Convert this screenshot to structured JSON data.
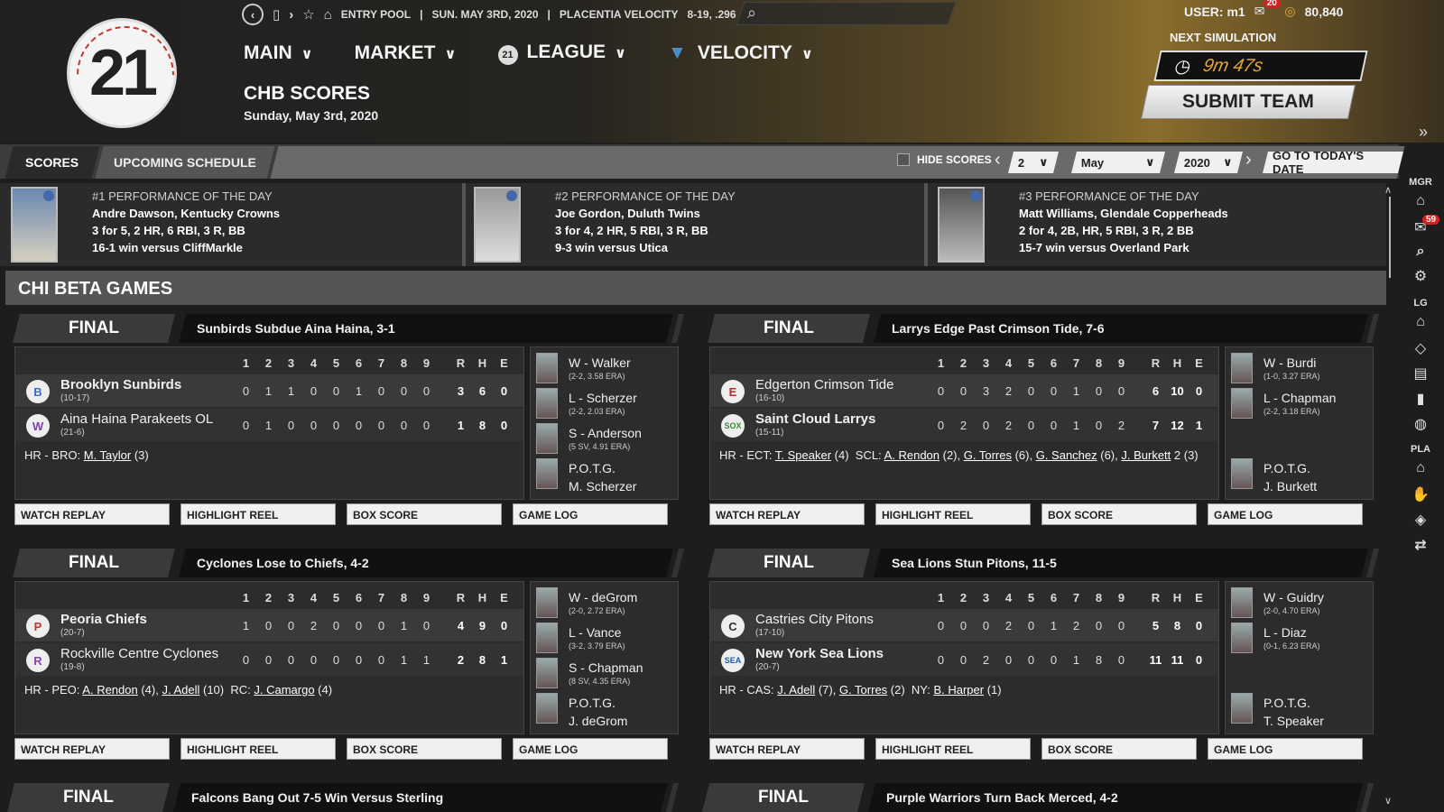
{
  "header": {
    "logo_text": "21",
    "topbar": {
      "league": "ENTRY POOL",
      "date": "SUN. MAY 3RD, 2020",
      "team": "PLACENTIA VELOCITY",
      "record": "8-19, .296"
    },
    "user": "USER: m1",
    "mail_count": "20",
    "coins": "80,840",
    "nav": [
      "MAIN",
      "MARKET",
      "LEAGUE",
      "VELOCITY"
    ],
    "page_title": "CHB SCORES",
    "page_date": "Sunday, May 3rd, 2020",
    "next_sim_label": "NEXT SIMULATION",
    "timer": "9m 47s",
    "submit_label": "SUBMIT TEAM"
  },
  "tabs": {
    "scores": "SCORES",
    "upcoming": "UPCOMING SCHEDULE",
    "hide_scores": "HIDE SCORES",
    "day": "2",
    "month": "May",
    "year": "2020",
    "today": "GO TO TODAY'S DATE"
  },
  "performances": [
    {
      "title": "#1 PERFORMANCE OF THE DAY",
      "player": "Andre Dawson, Kentucky Crowns",
      "line": "3 for 5, 2 HR, 6 RBI, 3 R, BB",
      "result": "16-1 win versus CliffMarkle"
    },
    {
      "title": "#2 PERFORMANCE OF THE DAY",
      "player": "Joe Gordon, Duluth Twins",
      "line": "3 for 4, 2 HR, 5 RBI, 3 R, BB",
      "result": "9-3 win versus Utica"
    },
    {
      "title": "#3 PERFORMANCE OF THE DAY",
      "player": "Matt Williams, Glendale Copperheads",
      "line": "2 for 4, 2B, HR, 5 RBI, 3 R, 2 BB",
      "result": "15-7 win versus Overland Park"
    }
  ],
  "section_title": "CHI BETA GAMES",
  "innings_header": [
    "1",
    "2",
    "3",
    "4",
    "5",
    "6",
    "7",
    "8",
    "9",
    "R",
    "H",
    "E"
  ],
  "buttons": [
    "WATCH REPLAY",
    "HIGHLIGHT REEL",
    "BOX SCORE",
    "GAME LOG"
  ],
  "games": [
    {
      "status": "FINAL",
      "headline": "Sunbirds Subdue Aina Haina, 3-1",
      "teams": [
        {
          "name": "Brooklyn Sunbirds",
          "record": "(10-17)",
          "line": [
            "0",
            "1",
            "1",
            "0",
            "0",
            "1",
            "0",
            "0",
            "0",
            "3",
            "6",
            "0"
          ],
          "winner": true,
          "logo": "B",
          "logo_color": "#3a6fc4"
        },
        {
          "name": "Aina Haina Parakeets OL",
          "record": "(21-6)",
          "line": [
            "0",
            "1",
            "0",
            "0",
            "0",
            "0",
            "0",
            "0",
            "0",
            "1",
            "8",
            "0"
          ],
          "winner": false,
          "logo": "W",
          "logo_color": "#7a3fb0"
        }
      ],
      "hr": [
        {
          "text": "HR - BRO: "
        },
        {
          "link": "M. Taylor"
        },
        {
          "text": " (3)"
        }
      ],
      "pitchers": [
        {
          "name": "W - Walker",
          "stat": "(2-2, 3.58 ERA)"
        },
        {
          "name": "L - Scherzer",
          "stat": "(2-2, 2.03 ERA)"
        },
        {
          "name": "S - Anderson",
          "stat": "(5 SV, 4.91 ERA)"
        },
        {
          "name": "P.O.T.G.",
          "stat": "M. Scherzer"
        }
      ]
    },
    {
      "status": "FINAL",
      "headline": "Larrys Edge Past Crimson Tide, 7-6",
      "teams": [
        {
          "name": "Edgerton Crimson Tide",
          "record": "(16-10)",
          "line": [
            "0",
            "0",
            "3",
            "2",
            "0",
            "0",
            "1",
            "0",
            "0",
            "6",
            "10",
            "0"
          ],
          "winner": false,
          "logo": "E",
          "logo_color": "#c0282a"
        },
        {
          "name": "Saint Cloud Larrys",
          "record": "(15-11)",
          "line": [
            "0",
            "2",
            "0",
            "2",
            "0",
            "0",
            "1",
            "0",
            "2",
            "7",
            "12",
            "1"
          ],
          "winner": true,
          "logo": "SOX",
          "logo_color": "#2f8f3a"
        }
      ],
      "hr": [
        {
          "text": "HR - ECT: "
        },
        {
          "link": "T. Speaker"
        },
        {
          "text": " (4)  SCL: "
        },
        {
          "link": "A. Rendon"
        },
        {
          "text": " (2), "
        },
        {
          "link": "G. Torres"
        },
        {
          "text": " (6), "
        },
        {
          "link": "G. Sanchez"
        },
        {
          "text": " (6), "
        },
        {
          "link": "J. Burkett"
        },
        {
          "text": " 2 (3)"
        }
      ],
      "pitchers": [
        {
          "name": "W - Burdi",
          "stat": "(1-0, 3.27 ERA)"
        },
        {
          "name": "L - Chapman",
          "stat": "(2-2, 3.18 ERA)"
        },
        {
          "name": "",
          "stat": ""
        },
        {
          "name": "P.O.T.G.",
          "stat": "J. Burkett"
        }
      ]
    },
    {
      "status": "FINAL",
      "headline": "Cyclones Lose to Chiefs, 4-2",
      "teams": [
        {
          "name": "Peoria Chiefs",
          "record": "(20-7)",
          "line": [
            "1",
            "0",
            "0",
            "2",
            "0",
            "0",
            "0",
            "1",
            "0",
            "4",
            "9",
            "0"
          ],
          "winner": true,
          "logo": "P",
          "logo_color": "#c0392b"
        },
        {
          "name": "Rockville Centre Cyclones",
          "record": "(19-8)",
          "line": [
            "0",
            "0",
            "0",
            "0",
            "0",
            "0",
            "0",
            "1",
            "1",
            "2",
            "8",
            "1"
          ],
          "winner": false,
          "logo": "R",
          "logo_color": "#8e44ad"
        }
      ],
      "hr": [
        {
          "text": "HR - PEO: "
        },
        {
          "link": "A. Rendon"
        },
        {
          "text": " (4), "
        },
        {
          "link": "J. Adell"
        },
        {
          "text": " (10)  RC: "
        },
        {
          "link": "J. Camargo"
        },
        {
          "text": " (4)"
        }
      ],
      "pitchers": [
        {
          "name": "W - deGrom",
          "stat": "(2-0, 2.72 ERA)"
        },
        {
          "name": "L - Vance",
          "stat": "(3-2, 3.79 ERA)"
        },
        {
          "name": "S - Chapman",
          "stat": "(8 SV, 4.35 ERA)"
        },
        {
          "name": "P.O.T.G.",
          "stat": "J. deGrom"
        }
      ]
    },
    {
      "status": "FINAL",
      "headline": "Sea Lions Stun Pitons, 11-5",
      "teams": [
        {
          "name": "Castries City Pitons",
          "record": "(17-10)",
          "line": [
            "0",
            "0",
            "0",
            "2",
            "0",
            "1",
            "2",
            "0",
            "0",
            "5",
            "8",
            "0"
          ],
          "winner": false,
          "logo": "C",
          "logo_color": "#333333"
        },
        {
          "name": "New York Sea Lions",
          "record": "(20-7)",
          "line": [
            "0",
            "0",
            "2",
            "0",
            "0",
            "0",
            "1",
            "8",
            "0",
            "11",
            "11",
            "0"
          ],
          "winner": true,
          "logo": "SEA",
          "logo_color": "#1f5fb4"
        }
      ],
      "hr": [
        {
          "text": "HR - CAS: "
        },
        {
          "link": "J. Adell"
        },
        {
          "text": " (7), "
        },
        {
          "link": "G. Torres"
        },
        {
          "text": " (2)  NY: "
        },
        {
          "link": "B. Harper"
        },
        {
          "text": " (1)"
        }
      ],
      "pitchers": [
        {
          "name": "W - Guidry",
          "stat": "(2-0, 4.70 ERA)"
        },
        {
          "name": "L - Diaz",
          "stat": "(0-1, 6.23 ERA)"
        },
        {
          "name": "",
          "stat": ""
        },
        {
          "name": "P.O.T.G.",
          "stat": "T. Speaker"
        }
      ]
    }
  ],
  "next_games": [
    {
      "status": "FINAL",
      "headline": "Falcons Bang Out 7-5 Win Versus Sterling"
    },
    {
      "status": "FINAL",
      "headline": "Purple Warriors Turn Back Merced, 4-2"
    }
  ],
  "right_sidebar": {
    "mgr_label": "MGR",
    "lg_label": "LG",
    "pla_label": "PLA",
    "notif_count": "59"
  },
  "colors": {
    "accent": "#e5a93a",
    "badge": "#d32020"
  }
}
